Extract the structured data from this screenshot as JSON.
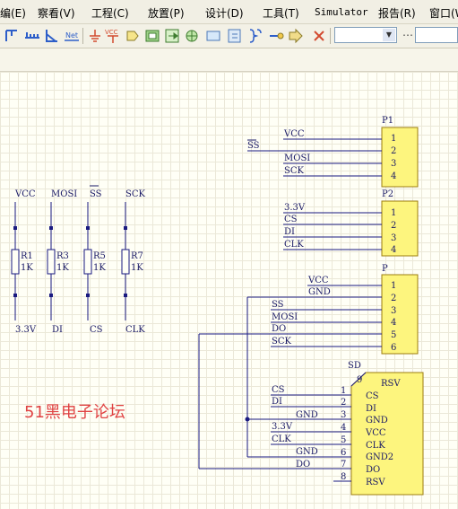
{
  "menu": {
    "items": [
      "编(E)",
      "察看(V)",
      "工程(C)",
      "放置(P)",
      "设计(D)",
      "工具(T)",
      "Simulator",
      "报告(R)",
      "窗口(W)"
    ]
  },
  "toolbar": {
    "icons": [
      "wire-tool-icon",
      "bus-tool-icon",
      "bus-entry-icon",
      "net-label-icon",
      "gnd-port-icon",
      "vcc-port-icon",
      "part-icon",
      "sheet-symbol-icon",
      "sheet-entry-icon",
      "device-sheet-icon",
      "port-icon",
      "harness-icon",
      "harness-connector-icon",
      "harness-entry-icon",
      "no-erc-icon"
    ],
    "net_label": "Net",
    "vcc_label": "VCC",
    "combo_value": ""
  },
  "schematic": {
    "resistor_headers": [
      "VCC",
      "MOSI",
      "SS",
      "SCK"
    ],
    "resistors": [
      {
        "ref": "R1",
        "value": "1K",
        "bottom": "3.3V"
      },
      {
        "ref": "R3",
        "value": "1K",
        "bottom": "DI"
      },
      {
        "ref": "R5",
        "value": "1K",
        "bottom": "CS"
      },
      {
        "ref": "R7",
        "value": "1K",
        "bottom": "CLK"
      }
    ],
    "p1": {
      "ref": "P1",
      "pins": [
        "1",
        "2",
        "3",
        "4"
      ],
      "nets": [
        "VCC",
        "MOSI",
        "SCK"
      ],
      "left_net": "SS"
    },
    "p2": {
      "ref": "P2",
      "pins": [
        "1",
        "2",
        "3",
        "4"
      ],
      "nets": [
        "3.3V",
        "CS",
        "DI",
        "CLK"
      ]
    },
    "p": {
      "ref": "P",
      "pins": [
        "1",
        "2",
        "3",
        "4",
        "5",
        "6"
      ],
      "nets": [
        "VCC",
        "GND",
        "SS",
        "MOSI",
        "DO",
        "SCK"
      ]
    },
    "sd": {
      "ref": "SD",
      "pin_numbers": [
        "9",
        "1",
        "2",
        "3",
        "4",
        "5",
        "6",
        "7",
        "8"
      ],
      "pin_names": [
        "RSV",
        "CS",
        "DI",
        "GND",
        "VCC",
        "CLK",
        "GND2",
        "DO",
        "RSV"
      ],
      "left_nets": [
        "CS",
        "DI",
        "GND",
        "3.3V",
        "CLK",
        "GND",
        "DO"
      ]
    },
    "watermark": "51黑电子论坛"
  }
}
